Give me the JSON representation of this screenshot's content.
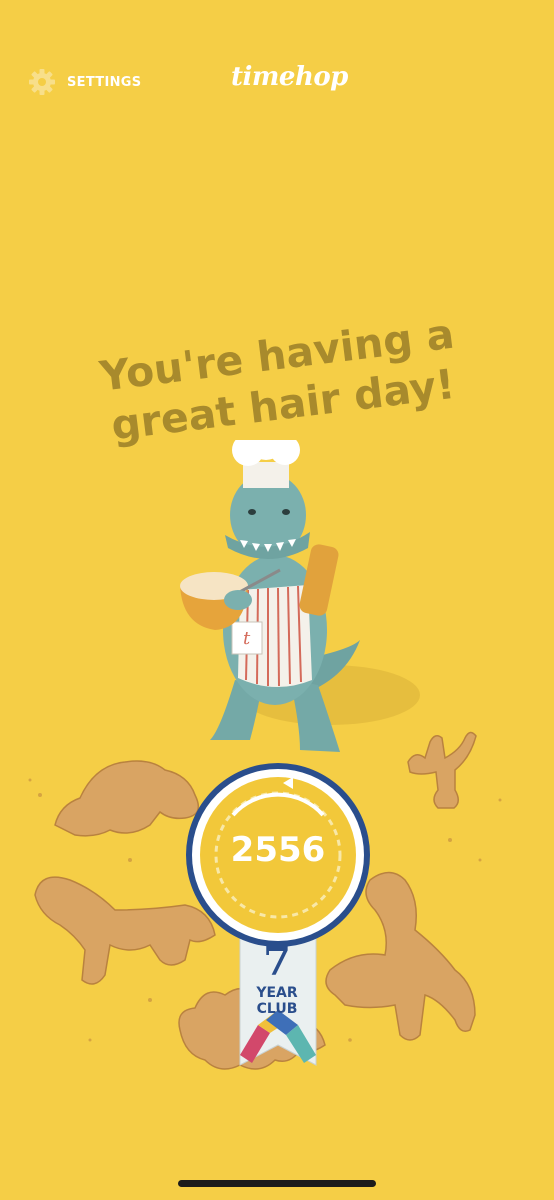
{
  "header": {
    "settings_label": "SETTINGS",
    "logo_text": "timehop",
    "settings_icon": "gear-icon"
  },
  "main": {
    "headline_line1": "You're having a",
    "headline_line2": "great hair day!"
  },
  "badge": {
    "count": "2556",
    "years": "7",
    "club_line1": "YEAR",
    "club_line2": "CLUB"
  },
  "colors": {
    "background": "#F5CE46",
    "headline": "#A88A2C",
    "badge_fill": "#F2C83A",
    "badge_border": "#2A4E8C",
    "ribbon": "#EAF0F0",
    "dino": "#7BB0AE",
    "cookie": "#D9A463"
  }
}
